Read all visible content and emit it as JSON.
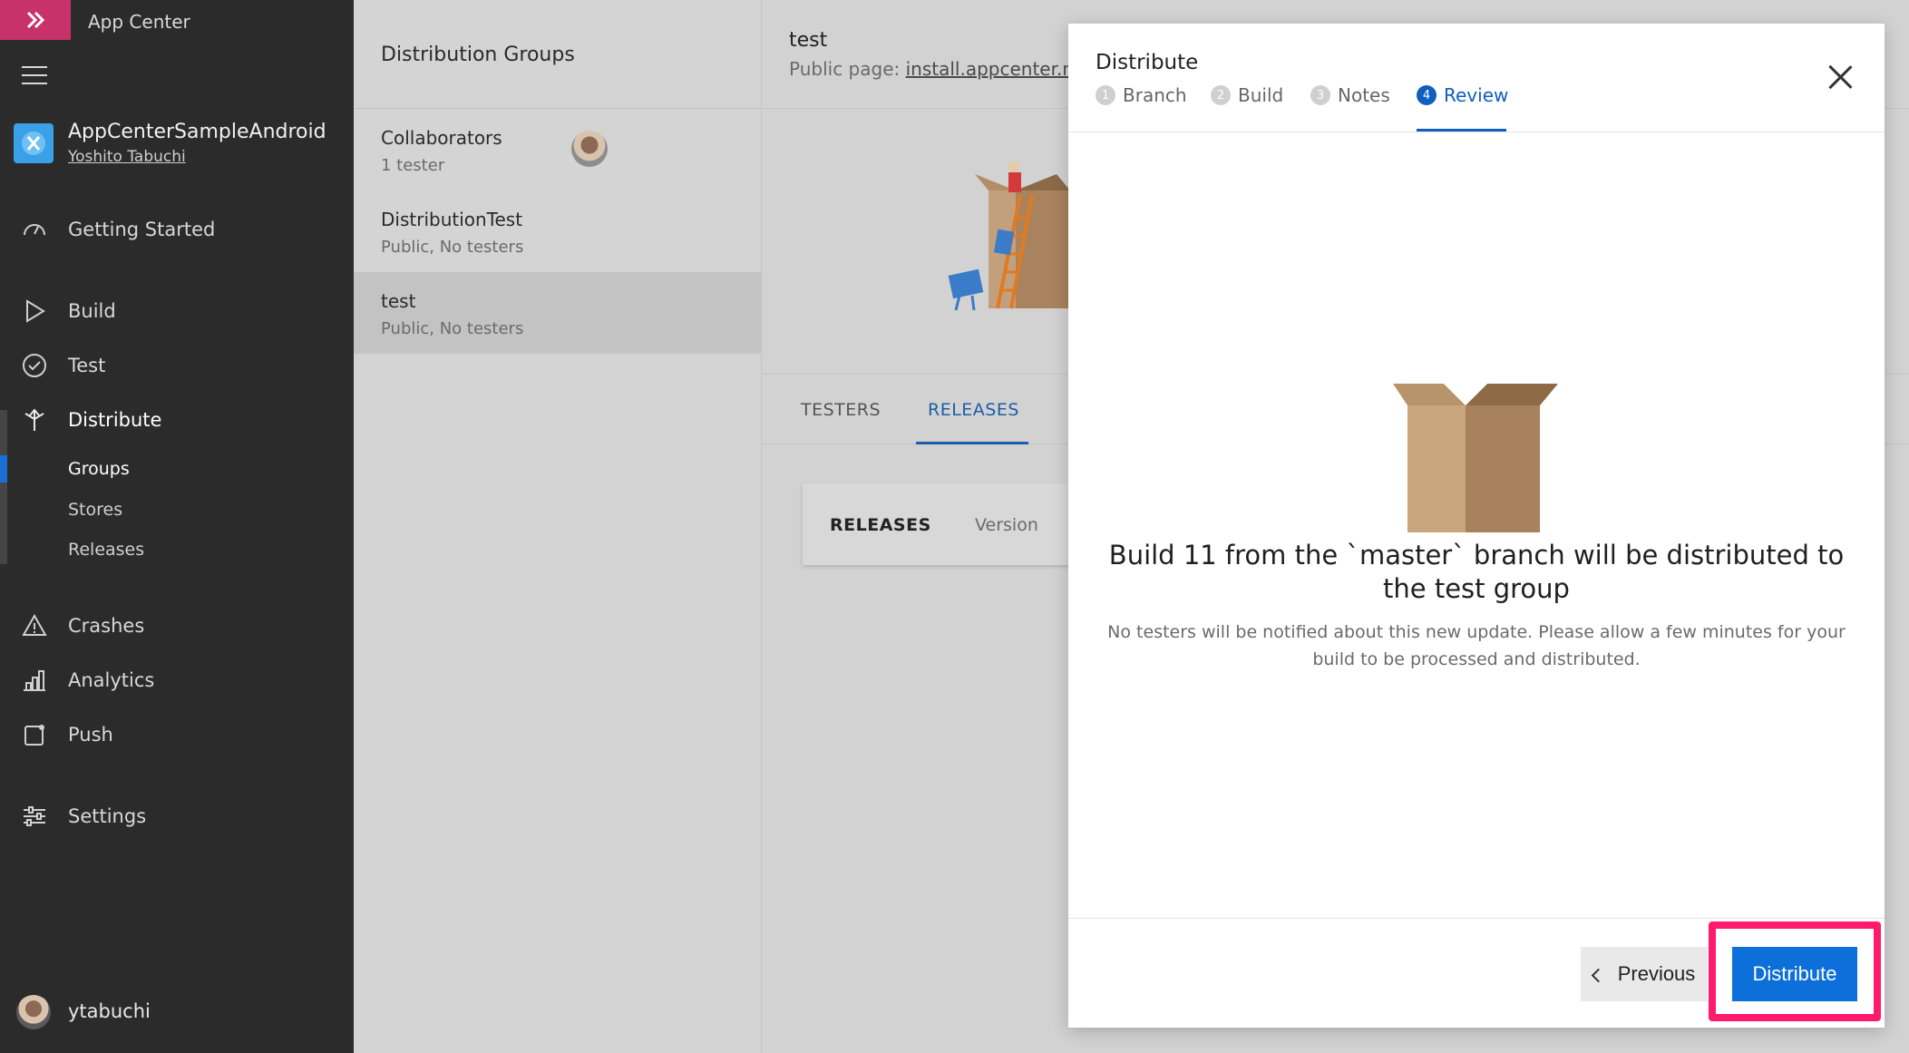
{
  "brand": {
    "name": "App Center"
  },
  "app": {
    "name": "AppCenterSampleAndroid",
    "owner": "Yoshito Tabuchi"
  },
  "nav": {
    "getting_started": "Getting Started",
    "build": "Build",
    "test": "Test",
    "distribute": "Distribute",
    "distribute_sub": [
      "Groups",
      "Stores",
      "Releases"
    ],
    "crashes": "Crashes",
    "analytics": "Analytics",
    "push": "Push",
    "settings": "Settings"
  },
  "user": {
    "name": "ytabuchi"
  },
  "groups": {
    "title": "Distribution Groups",
    "items": [
      {
        "name": "Collaborators",
        "sub": "1 tester"
      },
      {
        "name": "DistributionTest",
        "sub": "Public, No testers"
      },
      {
        "name": "test",
        "sub": "Public, No testers"
      }
    ]
  },
  "detail": {
    "title": "test",
    "public_label": "Public page: ",
    "public_link": "install.appcenter.ms/",
    "tabs": [
      "TESTERS",
      "RELEASES"
    ],
    "card_label": "RELEASES",
    "card_version": "Version"
  },
  "modal": {
    "title": "Distribute",
    "steps": [
      {
        "num": "1",
        "label": "Branch"
      },
      {
        "num": "2",
        "label": "Build"
      },
      {
        "num": "3",
        "label": "Notes"
      },
      {
        "num": "4",
        "label": "Review"
      }
    ],
    "active_step": "Review",
    "headline": "Build 11 from the `master` branch will be distributed to the test group",
    "description": "No testers will be notified about this new update. Please allow a few minutes for your build to be processed and distributed.",
    "previous_label": "Previous",
    "distribute_label": "Distribute"
  },
  "colors": {
    "sidebar": "#2b2b2b",
    "brand": "#c7326a",
    "accent": "#0d6fd9",
    "highlight": "#ff1a6b"
  }
}
